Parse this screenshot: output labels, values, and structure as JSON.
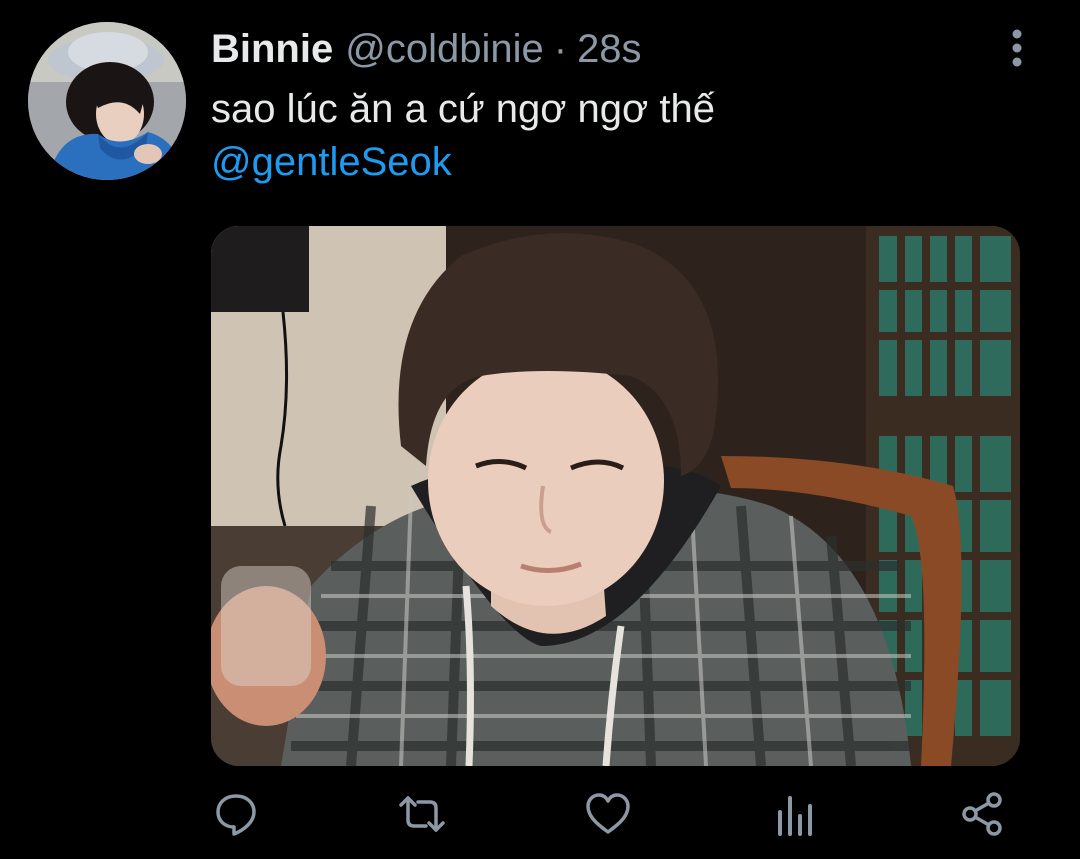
{
  "tweet": {
    "author_name": "Binnie",
    "handle": "@coldbinie",
    "separator": "·",
    "timestamp": "28s",
    "text_line": "sao lúc ăn a cứ ngơ ngơ thế",
    "mention": "@gentleSeok"
  },
  "icons": {
    "more": "more-vertical-icon",
    "reply": "reply-icon",
    "retweet": "retweet-icon",
    "like": "heart-icon",
    "analytics": "analytics-icon",
    "share": "share-icon"
  },
  "colors": {
    "background": "#000000",
    "text": "#e7e9ea",
    "secondary_text": "#8b98a5",
    "link": "#1d9bf0"
  }
}
